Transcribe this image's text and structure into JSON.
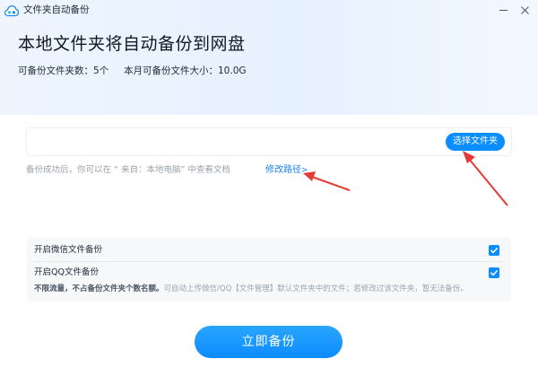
{
  "window": {
    "title": "文件夹自动备份",
    "icon": "cloud-icon",
    "controls": [
      "minimize-icon",
      "close-icon"
    ]
  },
  "header": {
    "headline": "本地文件夹将自动备份到网盘",
    "stats": {
      "folders_label": "可备份文件夹数：",
      "folders_value": "5个",
      "monthly_label": "本月可备份文件大小：",
      "monthly_value": "10.0G"
    }
  },
  "path": {
    "value": "",
    "choose_button": "选择文件夹",
    "hint": "备份成功后，你可以在 “ 来自：本地电脑” 中查看文档",
    "modify_link": "修改路径",
    "modify_arrow": ">"
  },
  "options": {
    "wechat_label": "开启微信文件备份",
    "wechat_checked": true,
    "qq_label": "开启QQ文件备份",
    "qq_checked": true,
    "note_bold": "不限流量，不占备份文件夹个数名额。",
    "note_rest": "可自动上传微信/QQ【文件管理】默认文件夹中的文件；若修改过该文件夹，暂无法备份。"
  },
  "actions": {
    "backup_button": "立即备份"
  },
  "colors": {
    "accent": "#0a8dff",
    "annotation": "#e53935"
  }
}
